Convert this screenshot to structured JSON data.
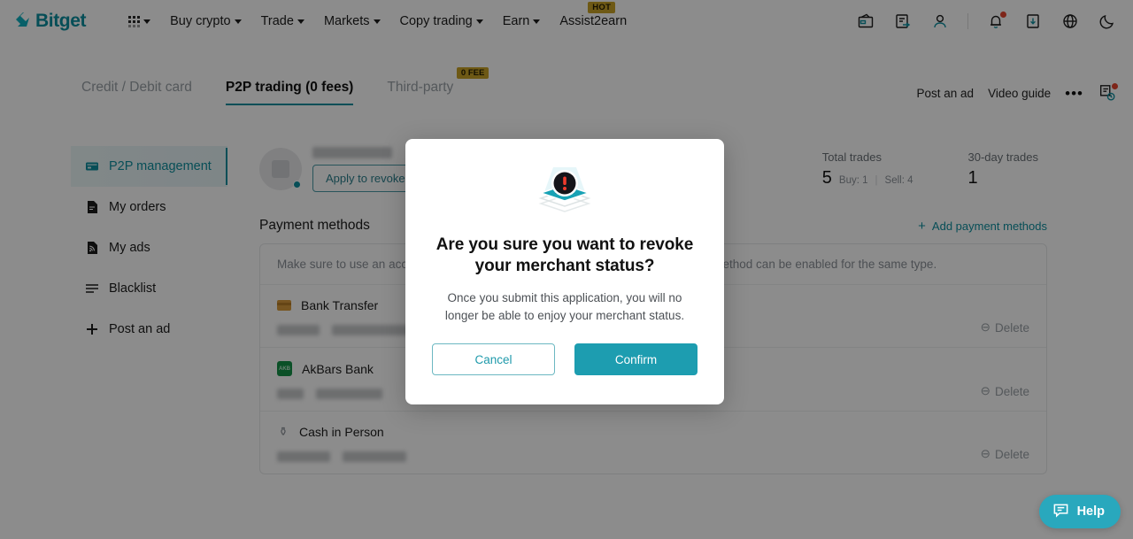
{
  "brand": {
    "name": "Bitget",
    "accent": "#0e8f9e",
    "badge_color": "#c9a227"
  },
  "topnav": {
    "items": [
      {
        "label": "Buy crypto",
        "caret": true
      },
      {
        "label": "Trade",
        "caret": true
      },
      {
        "label": "Markets",
        "caret": true
      },
      {
        "label": "Copy trading",
        "caret": true
      },
      {
        "label": "Earn",
        "caret": true
      },
      {
        "label": "Assist2earn",
        "caret": false,
        "badge": "HOT"
      }
    ],
    "icons": [
      "wallet-icon",
      "orders-icon",
      "profile-icon",
      "bell-icon",
      "download-icon",
      "globe-icon",
      "moon-icon"
    ]
  },
  "tabs": [
    {
      "label": "Credit / Debit card",
      "active": false
    },
    {
      "label": "P2P trading (0 fees)",
      "active": true
    },
    {
      "label": "Third-party",
      "active": false,
      "badge": "0 FEE"
    }
  ],
  "tabrow_right": {
    "post_ad": "Post an ad",
    "video_guide": "Video guide",
    "more": "•••"
  },
  "sidebar": {
    "items": [
      {
        "label": "P2P management",
        "icon": "card-icon",
        "active": true
      },
      {
        "label": "My orders",
        "icon": "document-icon",
        "active": false
      },
      {
        "label": "My ads",
        "icon": "rss-document-icon",
        "active": false
      },
      {
        "label": "Blacklist",
        "icon": "list-icon",
        "active": false
      },
      {
        "label": "Post an ad",
        "icon": "plus-icon",
        "active": false
      }
    ]
  },
  "profile": {
    "revoke_button": "Apply to revoke merchant status",
    "stats": [
      {
        "label": "Total trades",
        "value": "5",
        "buy": "Buy: 1",
        "sell": "Sell: 4"
      },
      {
        "label": "30-day trades",
        "value": "1"
      }
    ]
  },
  "payment_methods": {
    "title": "Payment methods",
    "add_label": "Add payment methods",
    "note": "Make sure to use an account registered under your own name. Only one payment method can be enabled for the same type.",
    "delete_label": "Delete",
    "rows": [
      {
        "name": "Bank Transfer",
        "icon": "bank-card-icon"
      },
      {
        "name": "AkBars Bank",
        "icon": "akbars-logo-icon"
      },
      {
        "name": "Cash in Person",
        "icon": "cash-icon"
      }
    ]
  },
  "help": {
    "label": "Help",
    "icon": "chat-bubble-icon"
  },
  "modal": {
    "icon": "warning-exclamation-icon",
    "title": "Are you sure you want to revoke your merchant status?",
    "body": "Once you submit this application, you will no longer be able to enjoy your merchant status.",
    "cancel": "Cancel",
    "confirm": "Confirm"
  }
}
